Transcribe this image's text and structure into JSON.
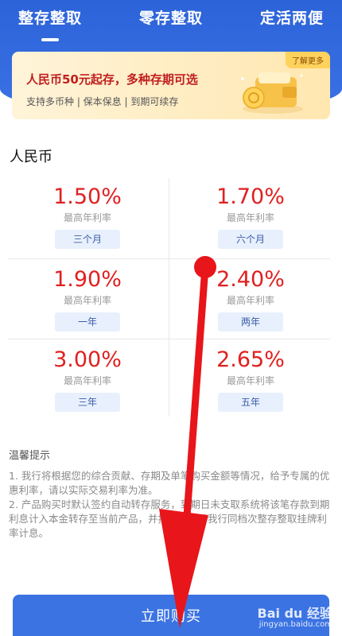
{
  "tabs": [
    {
      "label": "整存整取",
      "active": true
    },
    {
      "label": "零存整取",
      "active": false
    },
    {
      "label": "定活两便",
      "active": false
    }
  ],
  "promo": {
    "title": "人民币50元起存，多种存期可选",
    "subtitle": "支持多币种 | 保本保息 | 到期可续存",
    "badge": "了解更多"
  },
  "currency_title": "人民币",
  "rates": [
    {
      "rate": "1.50%",
      "label": "最高年利率",
      "term": "三个月"
    },
    {
      "rate": "1.70%",
      "label": "最高年利率",
      "term": "六个月"
    },
    {
      "rate": "1.90%",
      "label": "最高年利率",
      "term": "一年"
    },
    {
      "rate": "2.40%",
      "label": "最高年利率",
      "term": "两年"
    },
    {
      "rate": "3.00%",
      "label": "最高年利率",
      "term": "三年"
    },
    {
      "rate": "2.65%",
      "label": "最高年利率",
      "term": "五年"
    }
  ],
  "tips": {
    "title": "温馨提示",
    "line1": "1. 我行将根据您的综合贡献、存期及单笔购买金额等情况，给予专属的优惠利率，请以实际交易利率为准。",
    "line2": "2. 产品购买时默认签约自动转存服务，到期日未支取系统将该笔存款到期利息计入本金转存至当前产品，并按转存当日我行同档次整存整取挂牌利率计息。"
  },
  "buy_button": "立即购买",
  "watermark": {
    "main": "Bai du 经验",
    "sub": "jingyan.baidu.com"
  },
  "colors": {
    "brand": "#3b73e3",
    "rate": "#e02020",
    "annotation": "#e8151b"
  }
}
